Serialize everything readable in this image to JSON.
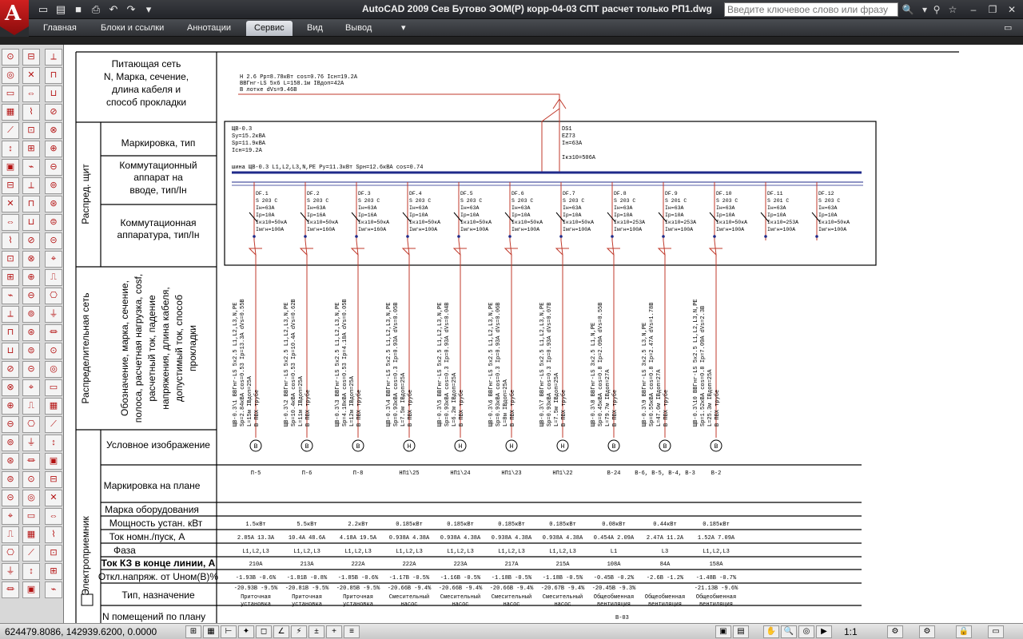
{
  "app": {
    "logo": "A",
    "title": "AutoCAD 2009 Сев Бутово ЭОМ(Р) корр-04-03 СПТ расчет только РП1.dwg",
    "search_placeholder": "Введите ключевое слово или фразу",
    "quick_access": [
      "new-icon",
      "open-icon",
      "save-icon",
      "print-icon",
      "undo-icon",
      "redo-icon",
      "dropdown-icon"
    ]
  },
  "ribbon": {
    "tabs": [
      "Главная",
      "Блоки и ссылки",
      "Аннотации",
      "Сервис",
      "Вид",
      "Вывод"
    ],
    "active_tab": "Сервис"
  },
  "drawing": {
    "left_headers": {
      "supply": "Питающая сеть N, Марка, сечение, длина кабеля и способ прокладки",
      "panel_group": "Распред. щит",
      "marking": "Маркировка, тип",
      "input_device": "Коммутационный аппарат на вводе, тип/Iн",
      "switch_gear": "Коммутационная аппаратура, тип/Iн",
      "dist_group": "Распределительная сеть",
      "dist_desc": "Обозначение, марка, сечение, полоса, расчетная нагрузка, cosf, расчетный ток, падение напряжения, длина кабеля, допустимый ток, способ прокладки",
      "symbol": "Условное изображение",
      "plan_mark": "Маркировка на плане",
      "equip_mark": "Марка оборудования",
      "power": "Мощность устан. кВт",
      "current": "Ток номн./пуск, А",
      "phase": "Фаза",
      "sc_current": "Ток КЗ в конце линии, А",
      "voltage_drop": "Откл.напряж. от Uном(В)%",
      "type_purpose": "Тип, назначение",
      "consumer_group": "Электроприемник",
      "rooms": "N помещений по плану"
    },
    "supply_lines": [
      "Н 2.6 Рр=8.78кВт cos=0.76 Iсн=19.2А",
      "ВВГнг-LS 5х6 L=158.1м IВдоп=42А",
      "В лотке dVs=9.46В"
    ],
    "panel": {
      "name_lines": [
        "ЩВ-0.3",
        "Sу=15.2кВА",
        "Sр=11.9кВА",
        "Iсн=19.2А"
      ],
      "input": [
        "DS1",
        "EZ73",
        "Iн=63А",
        "Iкз10=506А"
      ],
      "bus": "шина ЩВ-0.3 L1,L2,L3,N,PE Ру=11.3кВт Sрн=12.6кВА cos=0.74"
    },
    "breakers": [
      {
        "name": "DF.1",
        "l1": "S 203 C",
        "l2": "Iн=63А",
        "l3": "Iр=10А",
        "l4": "Iкз10=50кА",
        "l5": "Iмгн=100А"
      },
      {
        "name": "DF.2",
        "l1": "S 203 C",
        "l2": "Iн=63А",
        "l3": "Iр=16А",
        "l4": "Iкз10=50кА",
        "l5": "Iмгн=160А"
      },
      {
        "name": "DF.3",
        "l1": "S 203 C",
        "l2": "Iн=63А",
        "l3": "Iр=16А",
        "l4": "Iкз10=50кА",
        "l5": "Iмгн=160А"
      },
      {
        "name": "DF.4",
        "l1": "S 203 C",
        "l2": "Iн=63А",
        "l3": "Iр=10А",
        "l4": "Iкз10=50кА",
        "l5": "Iмгн=100А"
      },
      {
        "name": "DF.5",
        "l1": "S 203 C",
        "l2": "Iн=63А",
        "l3": "Iр=10А",
        "l4": "Iкз10=50кА",
        "l5": "Iмгн=100А"
      },
      {
        "name": "DF.6",
        "l1": "S 203 C",
        "l2": "Iн=63А",
        "l3": "Iр=10А",
        "l4": "Iкз10=50кА",
        "l5": "Iмгн=100А"
      },
      {
        "name": "DF.7",
        "l1": "S 203 C",
        "l2": "Iн=63А",
        "l3": "Iр=10А",
        "l4": "Iкз10=50кА",
        "l5": "Iмгн=100А"
      },
      {
        "name": "DF.8",
        "l1": "S 203 C",
        "l2": "Iн=63А",
        "l3": "Iр=10А",
        "l4": "Iкз10=253А",
        "l5": "Iмгн=100А"
      },
      {
        "name": "DF.9",
        "l1": "S 201 C",
        "l2": "Iн=63А",
        "l3": "Iр=10А",
        "l4": "Iкз10=253А",
        "l5": "Iмгн=100А"
      },
      {
        "name": "DF.10",
        "l1": "S 203 C",
        "l2": "Iн=63А",
        "l3": "Iр=10А",
        "l4": "Iкз10=50кА",
        "l5": "Iмгн=100А"
      },
      {
        "name": "DF.11",
        "l1": "S 201 C",
        "l2": "Iн=63А",
        "l3": "Iр=10А",
        "l4": "Iкз10=253А",
        "l5": "Iмгн=100А"
      },
      {
        "name": "DF.12",
        "l1": "S 203 C",
        "l2": "Iн=63А",
        "l3": "Iр=10А",
        "l4": "Iкз10=50кА",
        "l5": "Iмгн=100А"
      }
    ],
    "cables": [
      [
        "ЩВ-0.3\\1 ВВГнг-LS 5х2.5 L1,L2,L3,N,PE",
        "Sр=2.84кВА cos=0.53 Iр=13.3А dVs=0.55В",
        "L=15м IВдоп=25А",
        "В ПВХ трубе"
      ],
      [
        "ЩВ-0.3\\2 ВВГнг-LS 5х2.5 L1,L2,L3,N,PE",
        "Sр=10.4кВА cos=0.53 Iр=10.4А dVs=0.62В",
        "L=11м IВдоп=25А",
        "В ПВХ трубе"
      ],
      [
        "ЩВ-0.3\\3 ВВГнг-LS 5х2.5 L1,L2,L3,N,PE",
        "Sр=4.18кВА cos=0.53 Iр=4.18А dVs=0.05В",
        "L=12м IВдоп=25А",
        "В ПВХ трубе"
      ],
      [
        "ЩВ-0.3\\4 ВВГнг-LS 5х2.5 L1,L2,L3,N,PE",
        "Sр=0.93кВА cos=0.3 Iр=0.93А dVs=0.05В",
        "L=7.5м IВдоп=25А",
        "В ПВХ трубе"
      ],
      [
        "ЩВ-0.3\\5 ВВГнг-LS 5х2.5 L1,L2,L3,N,PE",
        "Sр=0.93кВА cos=0.3 Iр=0.93А dVs=0.04В",
        "L=6.2м IВдоп=25А",
        "В ПВХ трубе"
      ],
      [
        "ЩВ-0.3\\6 ВВГнг-LS 5х2.5 L1,L2,L3,N,PE",
        "Sр=0.93кВА cos=0.3 Iр=0.93А dVs=0.06В",
        "L=8м IВдоп=25А",
        "В ПВХ трубе"
      ],
      [
        "ЩВ-0.3\\7 ВВГнг-LS 5х2.5 L1,L2,L3,N,PE",
        "Sр=0.93кВА cos=0.3 Iр=0.93А dVs=0.07В",
        "L=7.5м IВдоп=25А",
        "В ПВХ трубе"
      ],
      [
        "ЩВ-0.3\\8 ВВГнг-LS 3х2.5 L1,N,PE",
        "Sр=0.45кВА cos=0.8 Iр=2.09А dVs=0.55В",
        "L=79.7м IВдоп=27А",
        "В ПВХ трубе"
      ],
      [
        "ЩВ-0.3\\9 ВВГнг-LS 3х2.5 L3,N,PE",
        "Sр=0.55кВА cos=0.8 Iр=2.47А dVs=1.78В",
        "L=47.6м IВдоп=27А",
        "В ПВХ трубе"
      ],
      [
        "ЩВ-0.3\\10 ВВГнг-LS 5х2.5 L1,L2,L3,N,PE",
        "Sр=1.52кВА cos=0.8 Iр=7.09А dVs=2.3В",
        "L=25.3м IВдоп=25А",
        "В ПВХ трубе"
      ]
    ],
    "consumers": [
      {
        "symbol": "В",
        "plan": "П-5",
        "power": "1.5кВт",
        "current": "2.85А 13.3А",
        "phase": "L1,L2,L3",
        "sc": "210А",
        "drop1": "-1.93В -0.6%",
        "drop2": "-20.93В -9.5%",
        "type": "Приточная установка"
      },
      {
        "symbol": "В",
        "plan": "П-6",
        "power": "5.5кВт",
        "current": "10.4А 48.6А",
        "phase": "L1,L2,L3",
        "sc": "213А",
        "drop1": "-1.81В -0.8%",
        "drop2": "-20.81В -9.5%",
        "type": "Приточная установка"
      },
      {
        "symbol": "В",
        "plan": "П-8",
        "power": "2.2кВт",
        "current": "4.18А 19.5А",
        "phase": "L1,L2,L3",
        "sc": "222А",
        "drop1": "-1.85В -0.6%",
        "drop2": "-20.85В -9.5%",
        "type": "Приточная установка"
      },
      {
        "symbol": "Н",
        "plan": "НП1\\25",
        "power": "0.185кВт",
        "current": "0.938А 4.38А",
        "phase": "L1,L2,L3",
        "sc": "222А",
        "drop1": "-1.17В -0.5%",
        "drop2": "-20.66В -9.4%",
        "type": "Смесительный насос"
      },
      {
        "symbol": "Н",
        "plan": "НП1\\24",
        "power": "0.185кВт",
        "current": "0.938А 4.38А",
        "phase": "L1,L2,L3",
        "sc": "223А",
        "drop1": "-1.16В -0.5%",
        "drop2": "-20.66В -9.4%",
        "type": "Смесительный насос"
      },
      {
        "symbol": "Н",
        "plan": "НП1\\23",
        "power": "0.185кВт",
        "current": "0.938А 4.38А",
        "phase": "L1,L2,L3",
        "sc": "217А",
        "drop1": "-1.18В -0.5%",
        "drop2": "-20.66В -9.4%",
        "type": "Смесительный насос"
      },
      {
        "symbol": "Н",
        "plan": "НП1\\22",
        "power": "0.185кВт",
        "current": "0.938А 4.38А",
        "phase": "L1,L2,L3",
        "sc": "215А",
        "drop1": "-1.18В -0.5%",
        "drop2": "-20.67В -9.4%",
        "type": "Смесительный насос"
      },
      {
        "symbol": "В",
        "plan": "В-24",
        "power": "0.08кВт",
        "current": "0.454А 2.09А",
        "phase": "L1",
        "sc": "108А",
        "drop1": "-0.45В -0.2%",
        "drop2": "-20.45В -9.3%",
        "type": "Общеобменная вентиляция"
      },
      {
        "symbol": "В",
        "plan": "В-6, В-5, В-4, В-3",
        "power": "0.44кВт",
        "current": "2.47А 11.2А",
        "phase": "L3",
        "sc": "84А",
        "drop1": "-2.6В -1.2%",
        "drop2": "",
        "type": "Общеобменная вентиляция"
      },
      {
        "symbol": "В",
        "plan": "В-2",
        "power": "0.185кВт",
        "current": "1.52А 7.09А",
        "phase": "L1,L2,L3",
        "sc": "158А",
        "drop1": "-1.48В -0.7%",
        "drop2": "-21.13В -9.6%",
        "type": "Общеобменная вентиляция"
      }
    ],
    "room_partial": "В-03"
  },
  "status": {
    "coords": "624479.8086, 142939.6200, 0.0000",
    "scale": "1:1"
  }
}
